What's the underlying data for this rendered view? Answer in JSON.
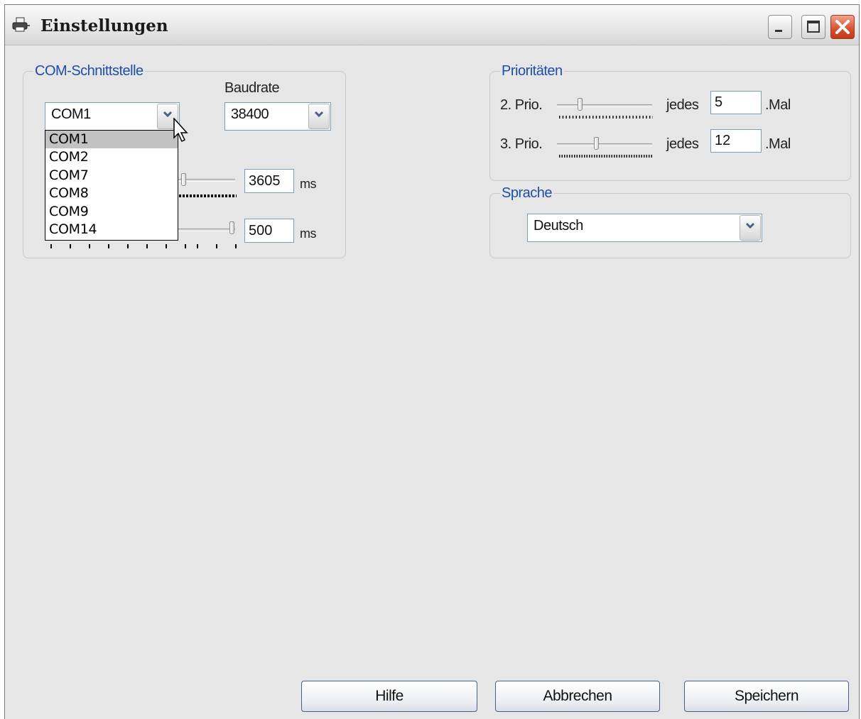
{
  "window": {
    "title": "Einstellungen",
    "icon": "printer-icon"
  },
  "com_group": {
    "legend": "COM-Schnittstelle",
    "port_value": "COM1",
    "port_options": [
      "COM1",
      "COM2",
      "COM7",
      "COM8",
      "COM9",
      "COM14"
    ],
    "port_selected_index": 0,
    "baud_label": "Baudrate",
    "baud_value": "38400",
    "timeout1_value": "3605",
    "timeout1_unit": "ms",
    "timeout2_value": "500",
    "timeout2_unit": "ms"
  },
  "prio_group": {
    "legend": "Prioritäten",
    "prio2_label": "2. Prio.",
    "prio2_every": "jedes",
    "prio2_value": "5",
    "prio2_times": ".Mal",
    "prio3_label": "3. Prio.",
    "prio3_every": "jedes",
    "prio3_value": "12",
    "prio3_times": ".Mal"
  },
  "lang_group": {
    "legend": "Sprache",
    "value": "Deutsch"
  },
  "buttons": {
    "help": "Hilfe",
    "cancel": "Abbrechen",
    "save": "Speichern"
  },
  "colors": {
    "legend_text": "#1d4fa8",
    "close_button": "#d6502e",
    "dialog_bg": "#e6e6e6",
    "selected_option": "#c2c2c2"
  }
}
